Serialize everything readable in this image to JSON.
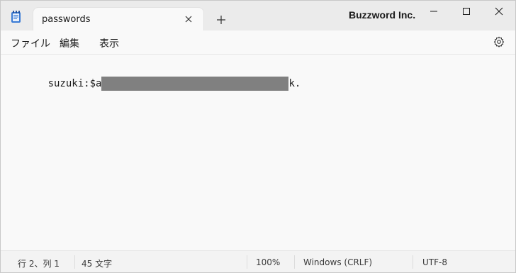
{
  "tab": {
    "title": "passwords",
    "new_tab_glyph": "+"
  },
  "brand": "Buzzword Inc.",
  "menu": {
    "file": "ファイル",
    "edit": "編集",
    "view": "表示"
  },
  "editor": {
    "line_prefix": "suzuki:$a",
    "line_suffix": "k."
  },
  "status": {
    "position": "行 2、列 1",
    "char_count": "45 文字",
    "zoom": "100%",
    "line_ending": "Windows (CRLF)",
    "encoding": "UTF-8"
  },
  "icons": {
    "app": "notepad-icon",
    "tab_close": "close-icon",
    "new_tab": "plus-icon",
    "minimize": "minimize-icon",
    "maximize": "maximize-icon",
    "close": "close-icon",
    "settings": "gear-icon"
  },
  "colors": {
    "redaction": "#808080",
    "app_icon": "#3a7bd5"
  }
}
